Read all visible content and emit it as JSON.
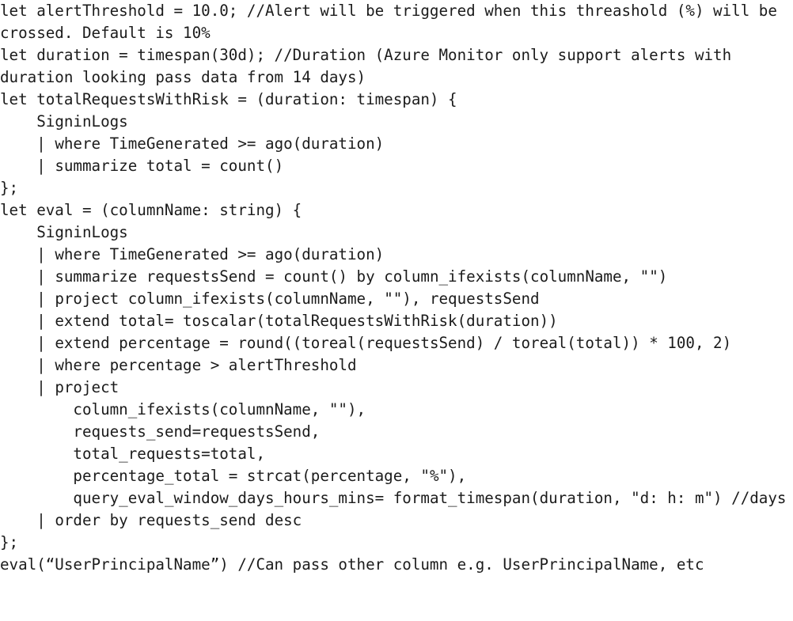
{
  "document": {
    "kind": "code-listing",
    "language": "KQL",
    "background_color": "#ffffff",
    "text_color": "#1b1b1b",
    "lines": [
      "let alertThreshold = 10.0; //Alert will be triggered when this threashold (%) will be crossed. Default is 10%",
      "let duration = timespan(30d); //Duration (Azure Monitor only support alerts with duration looking pass data from 14 days)",
      "let totalRequestsWithRisk = (duration: timespan) {",
      "    SigninLogs",
      "    | where TimeGenerated >= ago(duration)",
      "    | summarize total = count()",
      "};",
      "let eval = (columnName: string) {",
      "    SigninLogs",
      "    | where TimeGenerated >= ago(duration)",
      "    | summarize requestsSend = count() by column_ifexists(columnName, \"\")",
      "    | project column_ifexists(columnName, \"\"), requestsSend",
      "    | extend total= toscalar(totalRequestsWithRisk(duration))",
      "    | extend percentage = round((toreal(requestsSend) / toreal(total)) * 100, 2)",
      "    | where percentage > alertThreshold",
      "    | project",
      "        column_ifexists(columnName, \"\"),",
      "        requests_send=requestsSend,",
      "        total_requests=total,",
      "        percentage_total = strcat(percentage, \"%\"),",
      "        query_eval_window_days_hours_mins= format_timespan(duration, \"d: h: m\") //days",
      "    | order by requests_send desc",
      "};",
      "eval(“UserPrincipalName”) //Can pass other column e.g. UserPrincipalName, etc"
    ]
  }
}
